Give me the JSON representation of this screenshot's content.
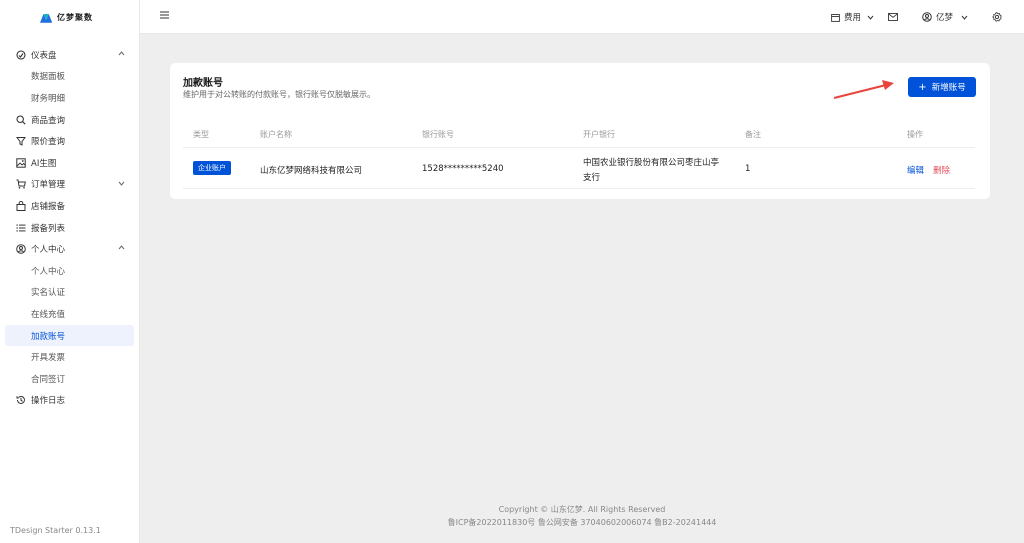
{
  "app": {
    "logo_text": "亿梦聚数",
    "version": "TDesign Starter 0.13.1"
  },
  "sidebar": {
    "items": [
      {
        "label": "仪表盘",
        "icon": "dashboard-icon",
        "expanded": true
      },
      {
        "label": "数据面板",
        "sub": true
      },
      {
        "label": "财务明细",
        "sub": true
      },
      {
        "label": "商品查询",
        "icon": "search-icon"
      },
      {
        "label": "限价查询",
        "icon": "filter-icon"
      },
      {
        "label": "AI生图",
        "icon": "image-icon"
      },
      {
        "label": "订单管理",
        "icon": "cart-icon",
        "expanded": false
      },
      {
        "label": "店铺报备",
        "icon": "bag-icon"
      },
      {
        "label": "报备列表",
        "icon": "list-icon"
      },
      {
        "label": "个人中心",
        "icon": "user-circle-icon",
        "expanded": true
      },
      {
        "label": "个人中心",
        "sub": true
      },
      {
        "label": "实名认证",
        "sub": true
      },
      {
        "label": "在线充值",
        "sub": true
      },
      {
        "label": "加款账号",
        "sub": true,
        "active": true
      },
      {
        "label": "开具发票",
        "sub": true
      },
      {
        "label": "合同签订",
        "sub": true
      },
      {
        "label": "操作日志",
        "icon": "history-icon"
      }
    ]
  },
  "header": {
    "fee_label": "费用",
    "user_label": "亿梦"
  },
  "card": {
    "title": "加款账号",
    "subtitle": "维护用于对公转账的付款账号，银行账号仅脱敏展示。",
    "add_button": "新增账号",
    "columns": [
      "类型",
      "账户名称",
      "银行账号",
      "开户银行",
      "备注",
      "操作"
    ],
    "rows": [
      {
        "type": "企业账户",
        "name": "山东亿梦网络科技有限公司",
        "account": "1528*********5240",
        "bank_line1": "中国农业银行股份有限公司枣庄山亭",
        "bank_line2": "支行",
        "note": "1",
        "edit": "编辑",
        "delete": "删除"
      }
    ]
  },
  "footer": {
    "copyright": "Copyright © 山东亿梦. All Rights Reserved",
    "icp": "鲁ICP备2022011830号   鲁公网安备 37040602006074   鲁B2-20241444"
  },
  "colors": {
    "primary": "#0052d9",
    "danger": "#e34d59",
    "annotation_arrow": "#e8453c"
  }
}
